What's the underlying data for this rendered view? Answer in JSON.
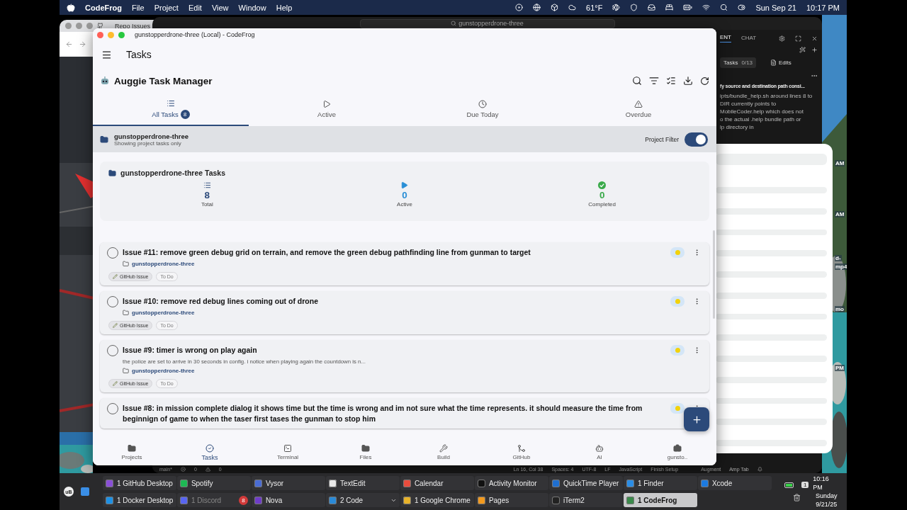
{
  "menu_bar": {
    "app": "CodeFrog",
    "menus": [
      "File",
      "Project",
      "Edit",
      "View",
      "Window",
      "Help"
    ],
    "weather": "61°F",
    "date": "Sun Sep 21",
    "time": "10:17 PM"
  },
  "background": {
    "browser_tab": "Repo Issues",
    "editor_search": "gunstopperdrone-three",
    "agent_tabs": [
      {
        "label": "ENT",
        "selected": true
      },
      {
        "label": "CHAT",
        "selected": false
      }
    ],
    "tasks_label": "Tasks",
    "tasks_count": "0/13",
    "edits_label": "Edits",
    "task_title": "fy source and destination path consi...",
    "task_lines": [
      "ipts/bundle_help.sh around lines 8 to",
      "DIR currently points to",
      "MobileCoder.help which does not",
      "o the actual .help bundle path or",
      "lp directory in"
    ],
    "status_bar": [
      "main*",
      "0",
      "0",
      "Ln 16, Col 38",
      "Spaces: 4",
      "UTF-8",
      "LF",
      "JavaScript",
      "Finish Setup",
      "Augment",
      "Amp Tab"
    ],
    "desktop_labels": [
      "AM",
      "AM",
      "d-",
      "mp4",
      "mo",
      "PM"
    ]
  },
  "window": {
    "title": "gunstopperdrone-three (Local) - CodeFrog"
  },
  "app_bar": {
    "title": "Tasks"
  },
  "header": {
    "title": "Auggie Task Manager"
  },
  "tabs": [
    {
      "kind": "all",
      "label": "All Tasks",
      "badge": "8",
      "selected": true
    },
    {
      "kind": "active",
      "label": "Active",
      "selected": false
    },
    {
      "kind": "due",
      "label": "Due Today",
      "selected": false
    },
    {
      "kind": "overdue",
      "label": "Overdue",
      "selected": false
    }
  ],
  "project_bar": {
    "name": "gunstopperdrone-three",
    "subtitle": "Showing project tasks only",
    "filter_label": "Project Filter",
    "filter_on": true
  },
  "stats": {
    "title": "gunstopperdrone-three Tasks",
    "items": [
      {
        "kind": "total",
        "value": "8",
        "label": "Total"
      },
      {
        "kind": "active",
        "value": "0",
        "label": "Active"
      },
      {
        "kind": "completed",
        "value": "0",
        "label": "Completed"
      }
    ]
  },
  "tasks": [
    {
      "title": "Issue #11: remove green debug grid on terrain, and remove the green debug pathfinding line from gunman to target",
      "project": "gunstopperdrone-three",
      "tags": [
        {
          "kind": "source",
          "label": "GitHub Issue"
        },
        {
          "kind": "status",
          "label": "To Do"
        }
      ],
      "checked": false
    },
    {
      "title": "Issue #10: remove red debug lines coming out of drone",
      "project": "gunstopperdrone-three",
      "tags": [
        {
          "kind": "source",
          "label": "GitHub Issue"
        },
        {
          "kind": "status",
          "label": "To Do"
        }
      ],
      "checked": false
    },
    {
      "title": "Issue #9: timer is wrong on play again",
      "description": "the police are set to arrive in 30 seconds in config. i notice when playing again the countdown is n...",
      "project": "gunstopperdrone-three",
      "tags": [
        {
          "kind": "source",
          "label": "GitHub Issue"
        },
        {
          "kind": "status",
          "label": "To Do"
        }
      ],
      "checked": false
    },
    {
      "title": "Issue #8: in mission complete dialog it shows time but the time is wrong and im not sure what the time represents. it should measure the time from beginnign of game to when the taser first tases the gunman to stop him",
      "checked": false
    }
  ],
  "bottom_nav": [
    {
      "kind": "projects",
      "label": "Projects",
      "selected": false
    },
    {
      "kind": "tasks",
      "label": "Tasks",
      "selected": true
    },
    {
      "kind": "terminal",
      "label": "Terminal",
      "selected": false
    },
    {
      "kind": "files",
      "label": "Files",
      "selected": false
    },
    {
      "kind": "build",
      "label": "Build",
      "selected": false
    },
    {
      "kind": "github",
      "label": "GitHub",
      "selected": false
    },
    {
      "kind": "ai",
      "label": "AI",
      "selected": false
    },
    {
      "kind": "project",
      "label": "gunsto..",
      "selected": false
    }
  ],
  "dock": {
    "launcher": "uB",
    "rows": [
      [
        {
          "label": "1 GitHub Desktop",
          "color": "#8a4fd8",
          "inactive": false,
          "selected": false
        },
        {
          "label": "Spotify",
          "color": "#1db954",
          "inactive": false,
          "selected": false
        },
        {
          "label": "Vysor",
          "color": "#4a6cd4",
          "inactive": false,
          "selected": false
        },
        {
          "label": "TextEdit",
          "color": "#e8e8e8",
          "inactive": false,
          "selected": false
        },
        {
          "label": "Calendar",
          "color": "#e94c3d",
          "inactive": false,
          "selected": false
        },
        {
          "label": "Activity Monitor",
          "color": "#111111",
          "inactive": false,
          "selected": false
        },
        {
          "label": "QuickTime Player",
          "color": "#1f6fd1",
          "inactive": false,
          "selected": false
        },
        {
          "label": "1 Finder",
          "color": "#2a8de6",
          "inactive": false,
          "selected": false
        },
        {
          "label": "Xcode",
          "color": "#1c7ae0",
          "inactive": false,
          "selected": false
        }
      ],
      [
        {
          "label": "1 Docker Desktop",
          "color": "#1d91e6",
          "inactive": false,
          "selected": false
        },
        {
          "label": "1 Discord",
          "color": "#5865f2",
          "inactive": true,
          "badge": "8",
          "selected": false
        },
        {
          "label": "Nova",
          "color": "#6f3cc8",
          "inactive": false,
          "selected": false
        },
        {
          "label": "2 Code",
          "color": "#2a8ad8",
          "inactive": false,
          "expandable": true,
          "selected": false
        },
        {
          "label": "1 Google Chrome",
          "color": "#e8b32a",
          "inactive": false,
          "selected": false
        },
        {
          "label": "Pages",
          "color": "#f39a1e",
          "inactive": false,
          "selected": false
        },
        {
          "label": "iTerm2",
          "color": "#222222",
          "inactive": false,
          "selected": false
        },
        {
          "label": "1 CodeFrog",
          "color": "#3a8a4a",
          "inactive": false,
          "selected": true
        }
      ]
    ],
    "space_count": "1",
    "clock": {
      "time": "10:16 PM",
      "day": "Sunday",
      "date": "9/21/25"
    }
  }
}
